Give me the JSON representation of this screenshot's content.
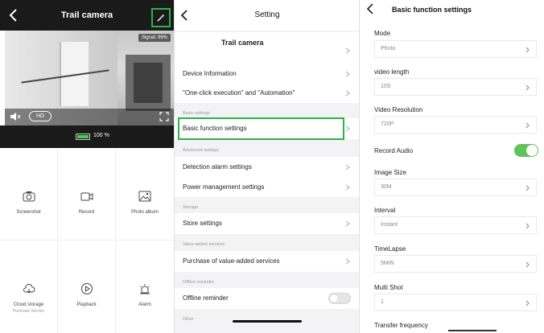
{
  "camera": {
    "title": "Trail camera",
    "signal": "Signal: 99%",
    "quality": "HD",
    "battery": "100 %",
    "battery_fraction": 1.0,
    "actions": [
      {
        "label": "Screenshot",
        "icon": "camera-icon"
      },
      {
        "label": "Record",
        "icon": "video-icon"
      },
      {
        "label": "Photo album",
        "icon": "image-icon"
      },
      {
        "label": "Cloud storage",
        "sub": "Purchase Service",
        "icon": "cloud-icon"
      },
      {
        "label": "Playback",
        "icon": "play-icon"
      },
      {
        "label": "Alarm",
        "icon": "alarm-icon"
      }
    ]
  },
  "settings": {
    "title": "Setting",
    "device_name": "Trail camera",
    "items": {
      "device_information": "Device Information",
      "one_click": "\"One-click execution\" and \"Automation\"",
      "basic_function": "Basic function settings",
      "detection_alarm": "Detection alarm settings",
      "power_management": "Power management settings",
      "store_settings": "Store settings",
      "purchase": "Purchase of value-added services",
      "offline_reminder": "Offline reminder"
    },
    "sections": {
      "basic": "Basic settings",
      "advanced": "Advanced settings",
      "storage": "Storage",
      "value_added": "Value-added services",
      "offline": "Offline reminder",
      "other": "Other"
    },
    "offline_reminder_on": false
  },
  "basic": {
    "title": "Basic function settings",
    "mode_label": "Mode",
    "mode_value": "Photo",
    "video_length_label": "video length",
    "video_length_value": "10S",
    "video_resolution_label": "Video Resolution",
    "video_resolution_value": "720P",
    "record_audio_label": "Record Audio",
    "record_audio_on": true,
    "image_size_label": "Image Size",
    "image_size_value": "30M",
    "interval_label": "Interval",
    "interval_value": "Instant",
    "timelapse_label": "TimeLapse",
    "timelapse_value": "5MIN",
    "multishot_label": "Multi Shot",
    "multishot_value": "1",
    "transfer_label": "Transfer frequency"
  },
  "colors": {
    "highlight": "#2db14a",
    "toggle_on": "#5cc45a",
    "battery_fill": "#3ed353"
  }
}
